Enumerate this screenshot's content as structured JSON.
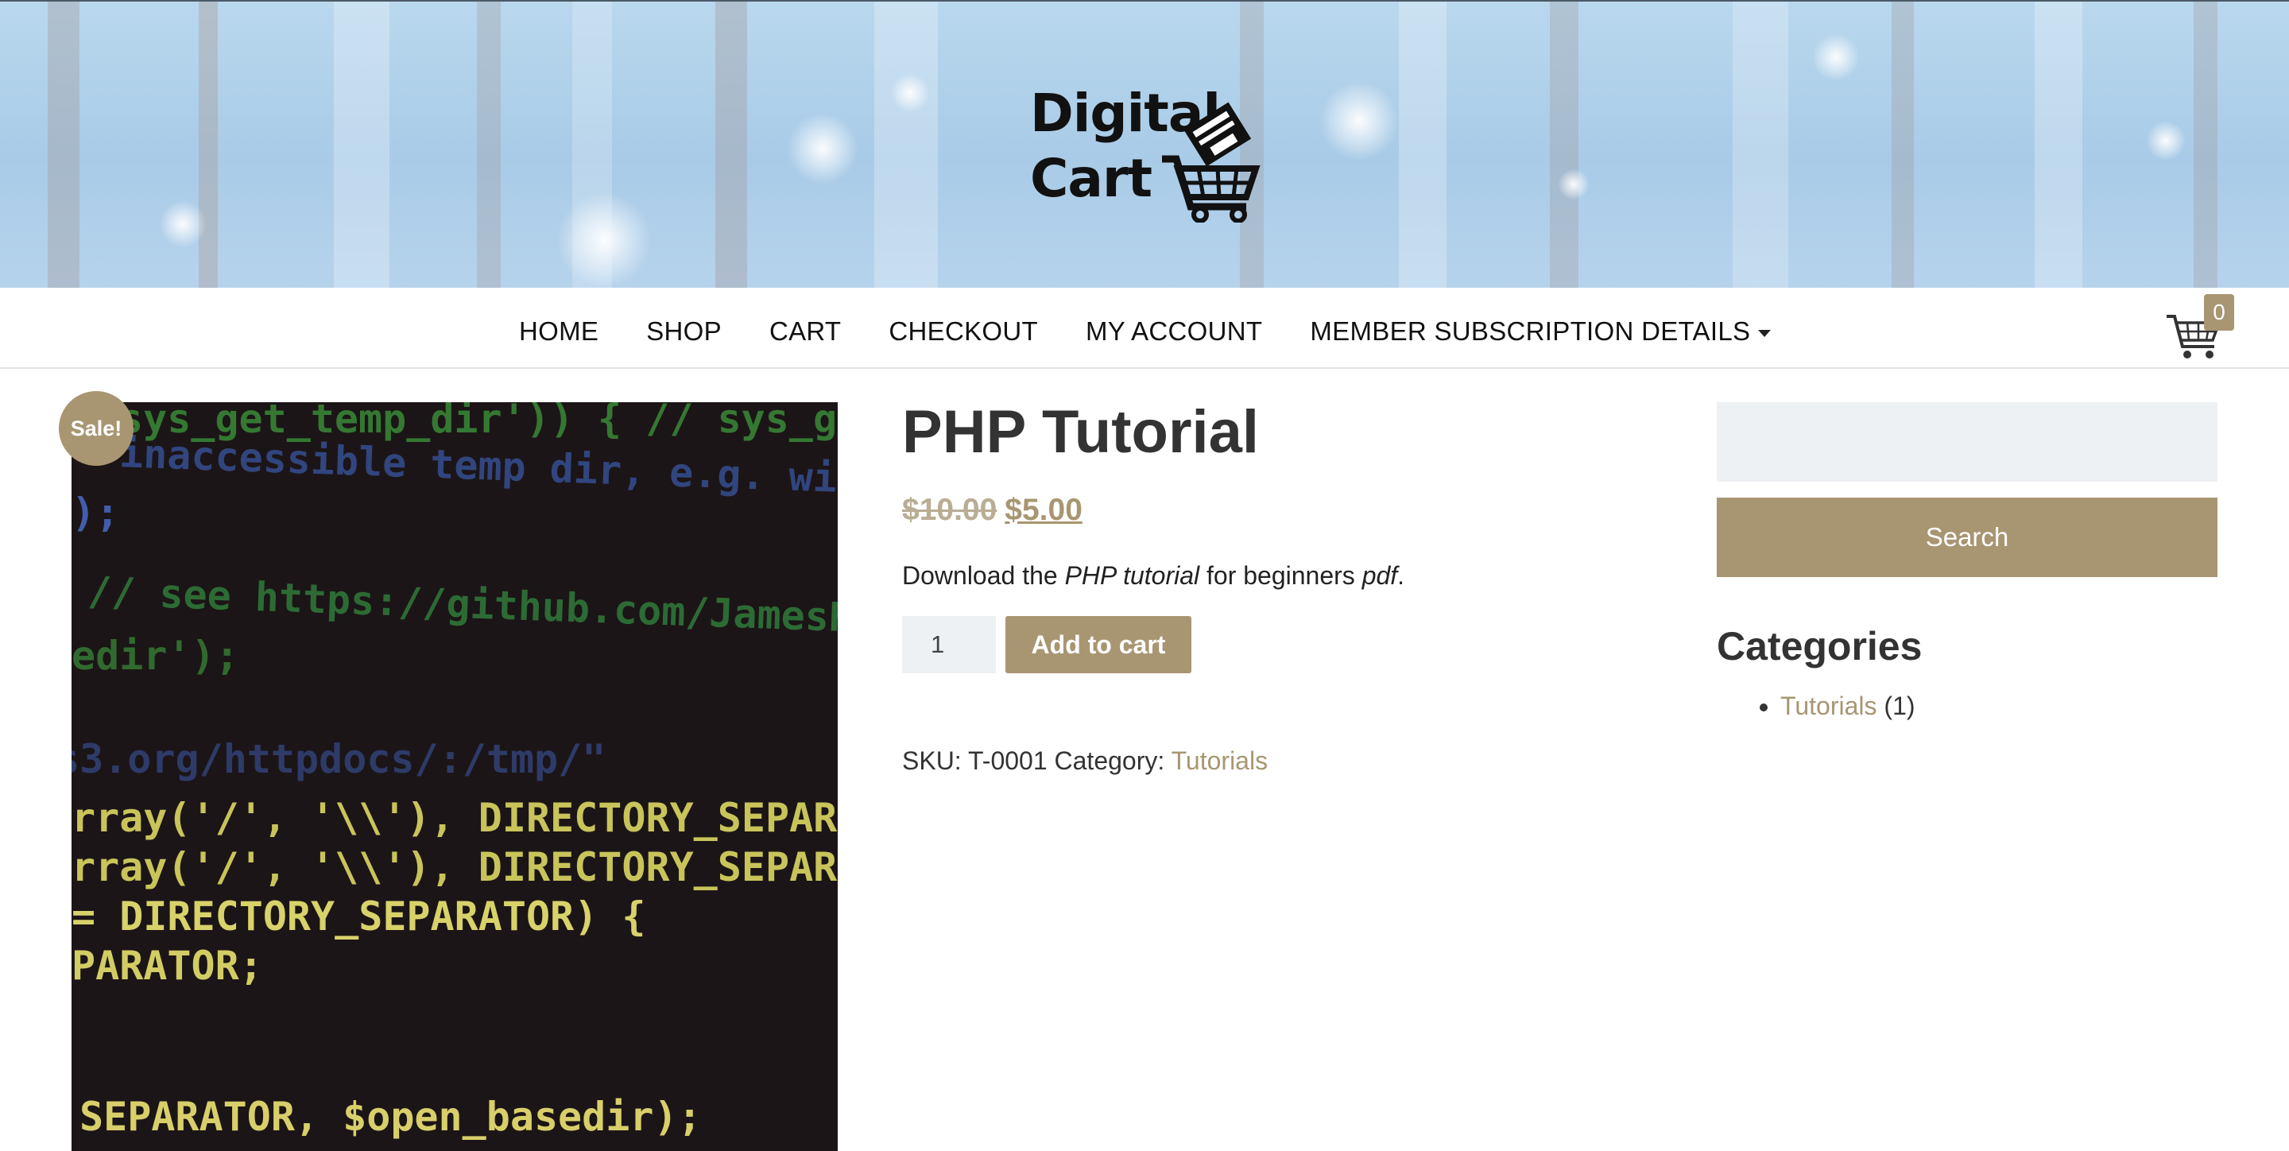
{
  "header": {
    "logo_line1": "Digital",
    "logo_line2": "Cart"
  },
  "nav": {
    "items": [
      {
        "label": "HOME"
      },
      {
        "label": "SHOP"
      },
      {
        "label": "CART"
      },
      {
        "label": "CHECKOUT"
      },
      {
        "label": "MY ACCOUNT"
      },
      {
        "label": "MEMBER SUBSCRIPTION DETAILS",
        "has_dropdown": true
      }
    ],
    "cart_count": "0"
  },
  "product": {
    "sale_badge": "Sale!",
    "title": "PHP Tutorial",
    "regular_price": "$10.00",
    "sale_price": "$5.00",
    "description": {
      "prefix": "Download the ",
      "em1": "PHP tutorial",
      "middle": " for beginners ",
      "em2": "pdf",
      "suffix": "."
    },
    "quantity": "1",
    "add_to_cart_label": "Add to cart",
    "sku_label": "SKU:",
    "sku": "T-0001",
    "category_label": "Category:",
    "category": "Tutorials",
    "image_code_lines": [
      "sys_get_temp_dir')) { // sys_get",
      "inaccessible temp dir, e.g. with",
      ");",
      "// see https://github.com/JamesHe",
      "edir');",
      "s3.org/httpdocs/:/tmp/\"",
      "rray('/', '\\\\'), DIRECTORY_SEPARATO",
      "rray('/', '\\\\'), DIRECTORY_SEPARATO",
      "= DIRECTORY_SEPARATOR) {",
      "PARATOR;",
      "SEPARATOR, $open_basedir);"
    ]
  },
  "sidebar": {
    "search_value": "",
    "search_button": "Search",
    "categories_title": "Categories",
    "categories": [
      {
        "name": "Tutorials",
        "count": "(1)"
      }
    ]
  },
  "colors": {
    "accent": "#a89672",
    "banner": "#b0d0ea",
    "input_bg": "#eef1f3"
  }
}
